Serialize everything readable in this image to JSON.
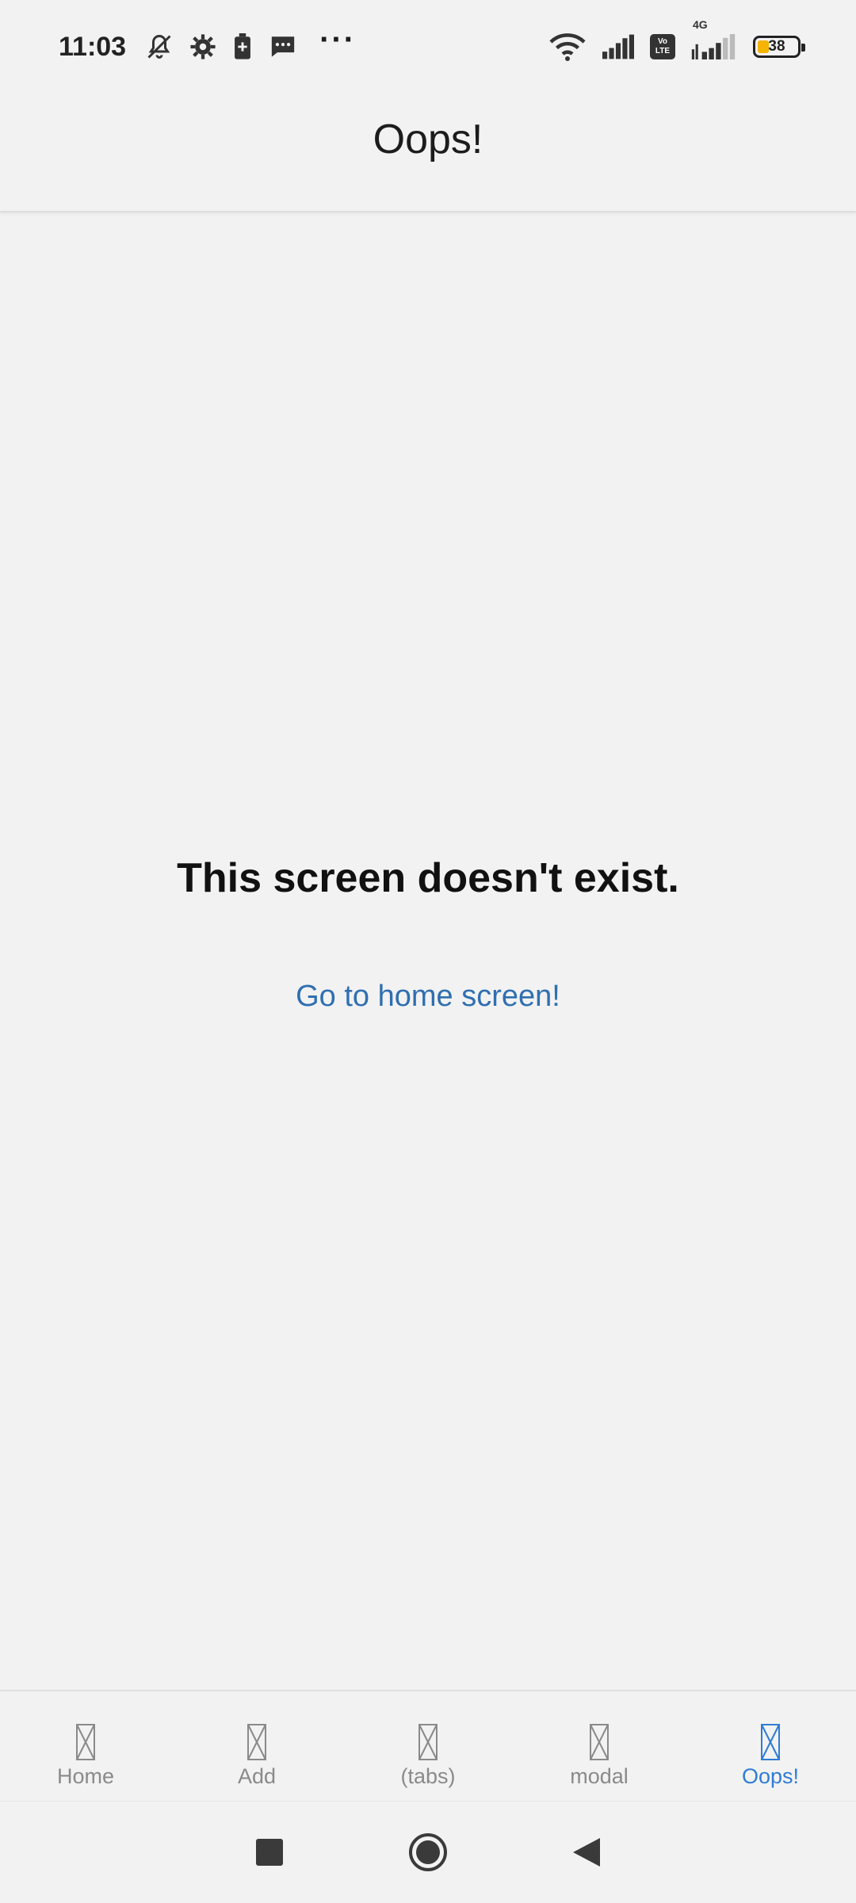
{
  "status_bar": {
    "time": "11:03",
    "icons": [
      "bell-off-icon",
      "gear-icon",
      "battery-saver-icon",
      "message-icon",
      "more-icon",
      "wifi-icon",
      "signal-icon",
      "volte-icon",
      "signal-4g-icon",
      "battery-icon"
    ],
    "network_label": "4G",
    "volte_label_top": "Vo",
    "volte_label_bottom": "LTE",
    "battery_level": "38",
    "battery_color": "#f5b400"
  },
  "header": {
    "title": "Oops!"
  },
  "main": {
    "message": "This screen doesn't exist.",
    "link_text": "Go to home screen!",
    "link_color": "#2f6fb0"
  },
  "tabs": [
    {
      "label": "Home",
      "active": false
    },
    {
      "label": "Add",
      "active": false
    },
    {
      "label": "(tabs)",
      "active": false
    },
    {
      "label": "modal",
      "active": false
    },
    {
      "label": "Oops!",
      "active": true
    }
  ],
  "colors": {
    "active_tab": "#2f7cd3",
    "inactive_tab": "#8a8a8a"
  },
  "nav_bar": {
    "buttons": [
      "recents-button",
      "home-button",
      "back-button"
    ]
  }
}
